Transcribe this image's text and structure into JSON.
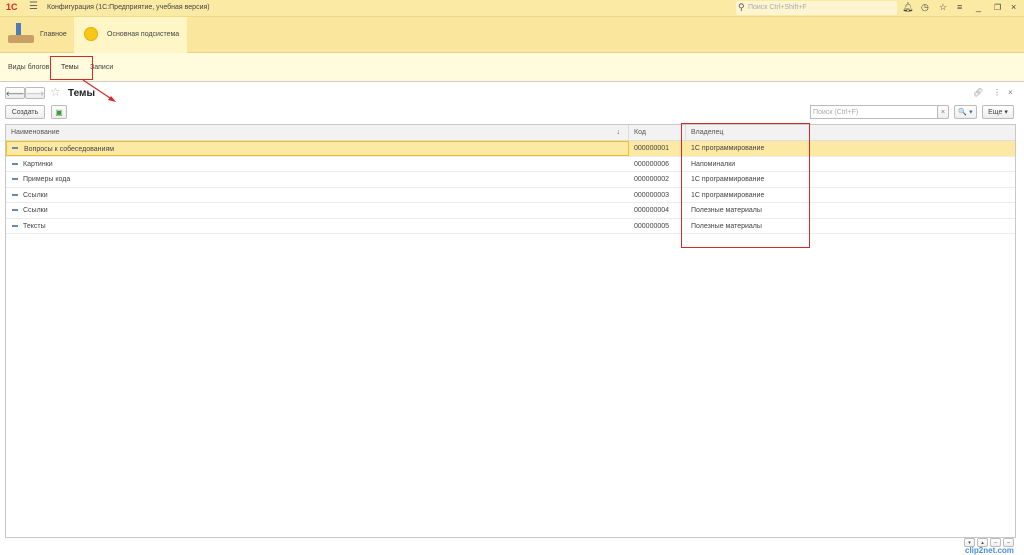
{
  "titlebar": {
    "logo": "1С",
    "title": "Конфигурация  (1С:Предприятие, учебная версия)",
    "search_placeholder": "Поиск Ctrl+Shift+F"
  },
  "sections": [
    {
      "label": "Главное"
    },
    {
      "label": "Основная подсистема"
    }
  ],
  "nav": [
    "Виды блогов",
    "Темы",
    "Записи"
  ],
  "form": {
    "title": "Темы",
    "create_label": "Создать",
    "search_placeholder": "Поиск (Ctrl+F)",
    "more_label": "Еще ▾",
    "search_btn": "🔍 ▾",
    "clear": "×"
  },
  "table": {
    "columns": [
      "Наименование",
      "Код",
      "Владелец"
    ],
    "sort_indicator": "↓",
    "rows": [
      {
        "name": "Вопросы к собеседованиям",
        "code": "000000001",
        "owner": "1С программирование"
      },
      {
        "name": "Картинки",
        "code": "000000006",
        "owner": "Напоминалки"
      },
      {
        "name": "Примеры кода",
        "code": "000000002",
        "owner": "1С программирование"
      },
      {
        "name": "Ссылки",
        "code": "000000003",
        "owner": "1С программирование"
      },
      {
        "name": "Ссылки",
        "code": "000000004",
        "owner": "Полезные материалы"
      },
      {
        "name": "Тексты",
        "code": "000000005",
        "owner": "Полезные материалы"
      }
    ]
  },
  "watermark": "clip2net.com",
  "colors": {
    "accent": "#fbe69e",
    "selected_row": "#fce9a4",
    "annotation": "#d42a2a"
  }
}
